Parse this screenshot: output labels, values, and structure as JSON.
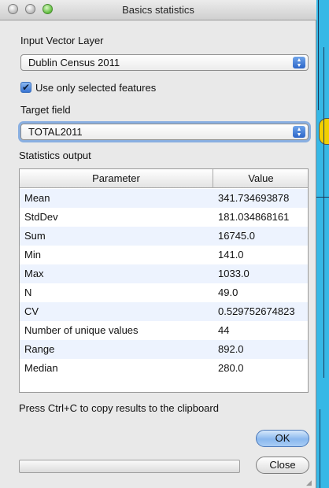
{
  "window": {
    "title": "Basics statistics"
  },
  "input_layer": {
    "label": "Input Vector Layer",
    "value": "Dublin Census 2011"
  },
  "selected_only": {
    "label": "Use only selected features",
    "checked": true
  },
  "target_field": {
    "label": "Target field",
    "value": "TOTAL2011"
  },
  "stats": {
    "label": "Statistics output",
    "columns": [
      "Parameter",
      "Value"
    ],
    "rows": [
      {
        "param": "Mean",
        "value": "341.734693878"
      },
      {
        "param": "StdDev",
        "value": "181.034868161"
      },
      {
        "param": "Sum",
        "value": "16745.0"
      },
      {
        "param": "Min",
        "value": "141.0"
      },
      {
        "param": "Max",
        "value": "1033.0"
      },
      {
        "param": "N",
        "value": "49.0"
      },
      {
        "param": "CV",
        "value": "0.529752674823"
      },
      {
        "param": "Number of unique values",
        "value": "44"
      },
      {
        "param": "Range",
        "value": "892.0"
      },
      {
        "param": "Median",
        "value": "280.0"
      }
    ]
  },
  "hint": "Press Ctrl+C to copy results to the clipboard",
  "buttons": {
    "ok": "OK",
    "close": "Close"
  },
  "progress": 0,
  "icons": {
    "checkmark": "✔",
    "arrows": "▲▼"
  }
}
